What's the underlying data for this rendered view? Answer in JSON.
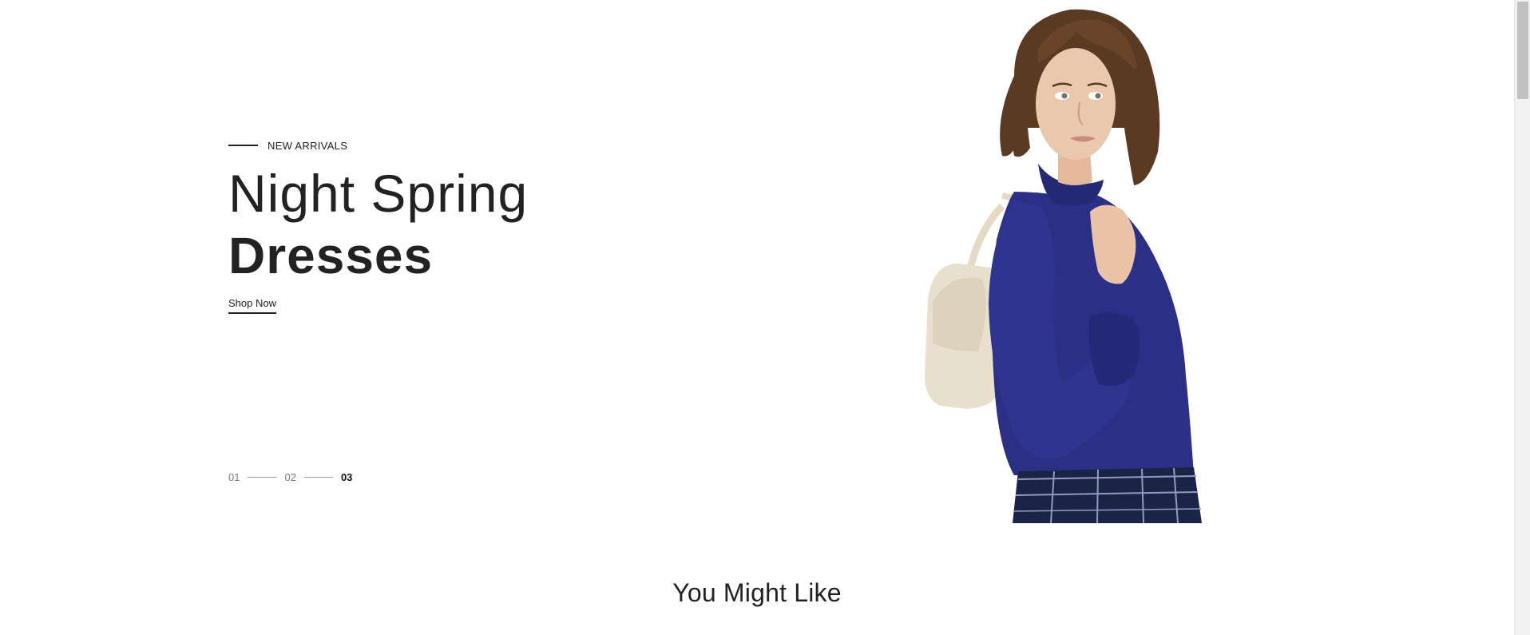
{
  "hero": {
    "eyebrow": "NEW ARRIVALS",
    "headline_light": "Night Spring",
    "headline_bold": "Dresses",
    "cta_label": "Shop Now"
  },
  "slider": {
    "pages": [
      "01",
      "02",
      "03"
    ],
    "active_page": "03"
  },
  "section": {
    "title": "You Might Like"
  },
  "colors": {
    "text": "#222222",
    "blouse": "#2b2f85",
    "jeans": "#1b2447",
    "bag": "#e8dfcd",
    "hair": "#5a3a22",
    "skin": "#e9c2a6"
  }
}
